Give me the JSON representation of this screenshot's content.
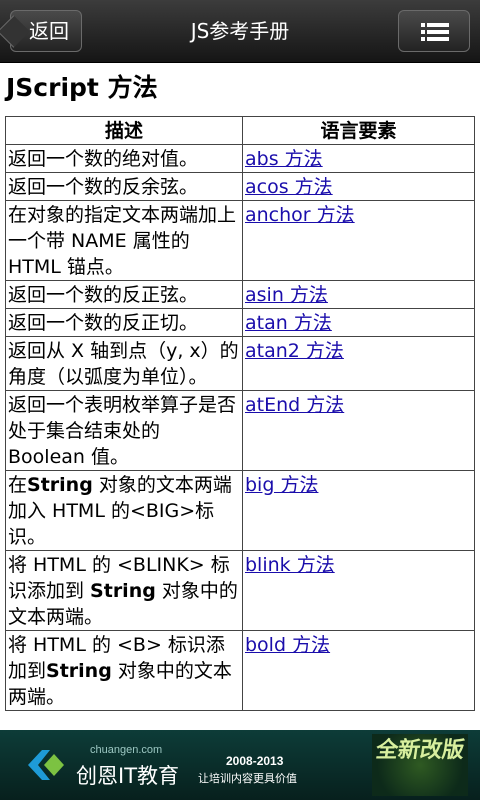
{
  "header": {
    "back_label": "返回",
    "title": "JS参考手册",
    "menu_icon": "list-icon"
  },
  "page": {
    "heading": "JScript 方法"
  },
  "table": {
    "columns": [
      "描述",
      "语言要素"
    ],
    "rows": [
      {
        "desc": [
          {
            "t": "返回一个数的绝对值。"
          }
        ],
        "link": "abs 方法"
      },
      {
        "desc": [
          {
            "t": "返回一个数的反余弦。"
          }
        ],
        "link": "acos 方法"
      },
      {
        "desc": [
          {
            "t": "在对象的指定文本两端加上一个带 NAME 属性的 HTML 锚点。"
          }
        ],
        "link": "anchor 方法"
      },
      {
        "desc": [
          {
            "t": "返回一个数的反正弦。"
          }
        ],
        "link": "asin 方法"
      },
      {
        "desc": [
          {
            "t": "返回一个数的反正切。"
          }
        ],
        "link": "atan 方法"
      },
      {
        "desc": [
          {
            "t": "返回从 X 轴到点（y, x）的角度（以弧度为单位）。"
          }
        ],
        "link": "atan2 方法"
      },
      {
        "desc": [
          {
            "t": "返回一个表明枚举算子是否处于集合结束处的 Boolean 值。"
          }
        ],
        "link": "atEnd 方法"
      },
      {
        "desc": [
          {
            "t": "在"
          },
          {
            "t": "String",
            "b": true
          },
          {
            "t": " 对象的文本两端加入 HTML 的<BIG>标识。"
          }
        ],
        "link": "big 方法"
      },
      {
        "desc": [
          {
            "t": "将 HTML 的 <BLINK> 标识添加到 "
          },
          {
            "t": "String",
            "b": true
          },
          {
            "t": " 对象中的文本两端。"
          }
        ],
        "link": "blink 方法"
      },
      {
        "desc": [
          {
            "t": "将 HTML 的 <B> 标识添加到"
          },
          {
            "t": "String",
            "b": true
          },
          {
            "t": " 对象中的文本两端。"
          }
        ],
        "link": "bold 方法"
      }
    ]
  },
  "banner": {
    "url": "chuangen.com",
    "brand": "创恩IT教育",
    "years": "2008-2013",
    "slogan": "让培训内容更具价值",
    "badge": "全新改版",
    "logo_icon": "chuangen-logo-icon"
  }
}
